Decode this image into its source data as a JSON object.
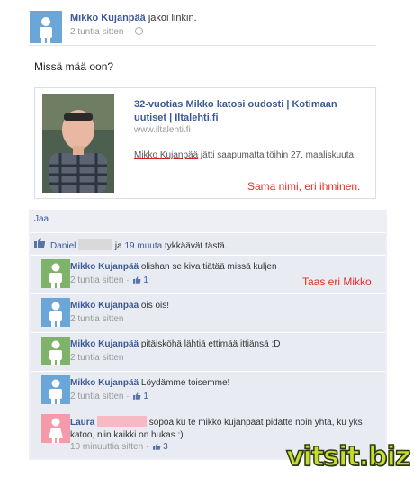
{
  "post": {
    "author": "Mikko Kujanpää",
    "action": "jakoi linkin.",
    "time": "2 tuntia sitten",
    "message": "Missä mää oon?"
  },
  "share": {
    "title": "32-vuotias Mikko katosi oudosti | Kotimaan uutiset | Iltalehti.fi",
    "domain": "www.iltalehti.fi",
    "desc_name": "Mikko Kujanpää",
    "desc_rest": " jätti saapumatta töihin 27. maaliskuuta."
  },
  "annotations": {
    "share_note": "Sama nimi, eri ihminen.",
    "comment_note": "Taas eri Mikko."
  },
  "actions": {
    "like": "Jaa"
  },
  "likes": {
    "name": "Daniel",
    "middle": " ja ",
    "others": "19 muuta",
    "suffix": " tykkäävät tästä."
  },
  "comments": [
    {
      "author": "Mikko Kujanpää",
      "text": " olishan se kiva tiätää missä kuljen",
      "time": "2 tuntia sitten",
      "likes": "1",
      "avatar": "green"
    },
    {
      "author": "Mikko Kujanpää",
      "text": " ois ois!",
      "time": "2 tuntia sitten",
      "likes": "",
      "avatar": "blue"
    },
    {
      "author": "Mikko Kujanpää",
      "text": " pitäisköhä lähtiä ettimää ittiänsä :D",
      "time": "2 tuntia sitten",
      "likes": "",
      "avatar": "green"
    },
    {
      "author": "Mikko Kujanpää",
      "text": " Löydämme toisemme!",
      "time": "2 tuntia sitten",
      "likes": "1",
      "avatar": "blue"
    },
    {
      "author": "Laura",
      "text": "söpöä ku te mikko kujanpäät pidätte noin yhtä, ku yks katoo, niin kaikki on hukas :)",
      "time": "10 minuuttia sitten",
      "likes": "3",
      "avatar": "pink"
    }
  ],
  "meta_sep": " · ",
  "watermark": "vitsit.biz",
  "colors": {
    "fb_blue": "#3b5998",
    "annotation_red": "#e0302a",
    "watermark_green": "#c7dc30"
  }
}
